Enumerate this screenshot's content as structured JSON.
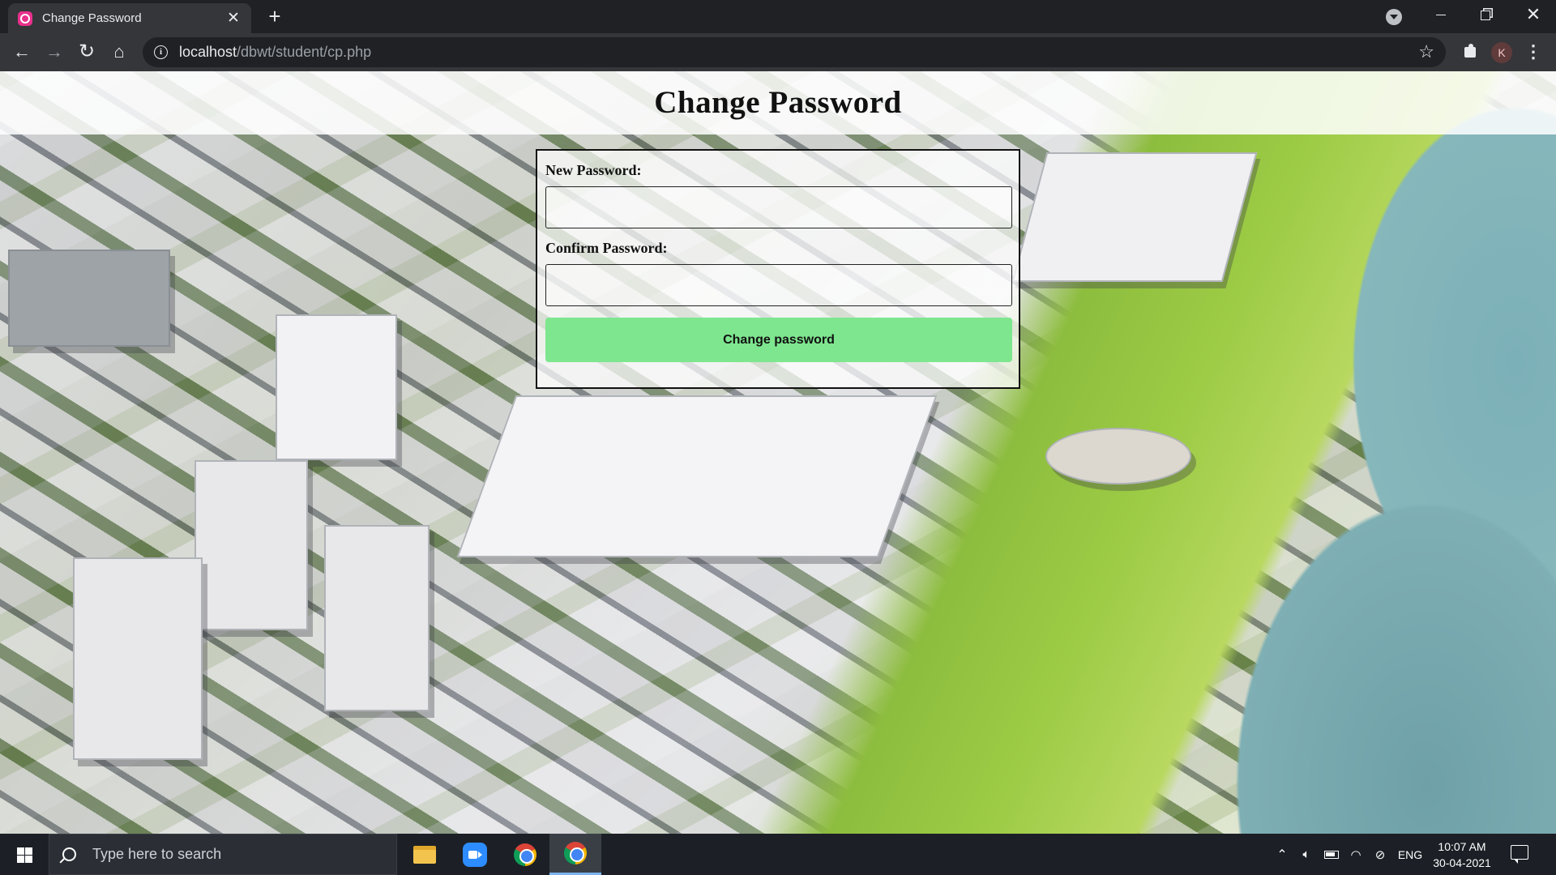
{
  "browser": {
    "tab_title": "Change Password",
    "tab_close_glyph": "✕",
    "new_tab_glyph": "+",
    "url_host": "localhost",
    "url_path": "/dbwt/student/cp.php",
    "profile_initial": "K",
    "favicon_color": "#e8308c"
  },
  "page": {
    "title": "Change Password",
    "new_password_label": "New Password:",
    "confirm_password_label": "Confirm Password:",
    "new_password_value": "",
    "confirm_password_value": "",
    "submit_label": "Change password",
    "submit_color": "#7ee68f"
  },
  "taskbar": {
    "search_placeholder": "Type here to search",
    "language": "ENG",
    "time": "10:07 AM",
    "date": "30-04-2021"
  }
}
